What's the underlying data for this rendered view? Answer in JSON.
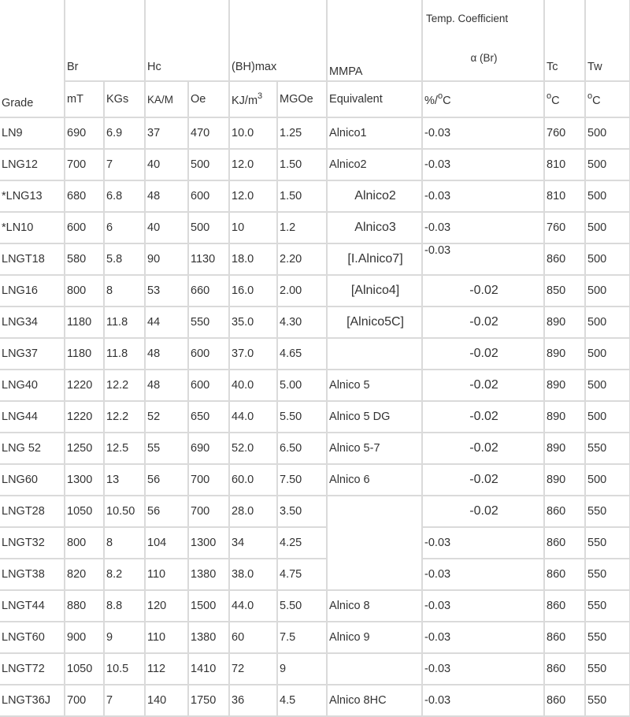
{
  "header": {
    "grade": "Grade",
    "br": "Br",
    "hc": "Hc",
    "bhmax": "(BH)max",
    "mmpa_line1": "MMPA",
    "mmpa_line2": "Equivalent",
    "temp_coef_title": "Temp. Coefficient",
    "temp_coef_symbol": "α (Br)",
    "tc": "Tc",
    "tw": "Tw",
    "unit_mt": "mT",
    "unit_kgs": "KGs",
    "unit_kam": "KA/M",
    "unit_oe": "Oe",
    "unit_kjm_base": "KJ/m",
    "unit_kjm_exp": "3",
    "unit_mgoe": "MGOe",
    "unit_pct_pre": "%/",
    "unit_deg": "o",
    "unit_c": "C"
  },
  "rows": [
    {
      "grade": "LN9",
      "mt": "690",
      "kgs": "6.9",
      "kam": "37",
      "oe": "470",
      "kjm": "10.0",
      "mgoe": "1.25",
      "mmpa": "Alnico1",
      "tcoef": "-0.03",
      "tc": "760",
      "tw": "500"
    },
    {
      "grade": "LNG12",
      "mt": "700",
      "kgs": "7",
      "kam": "40",
      "oe": "500",
      "kjm": "12.0",
      "mgoe": "1.50",
      "mmpa": "Alnico2",
      "tcoef": "-0.03",
      "tc": "810",
      "tw": "500"
    },
    {
      "grade": "*LNG13",
      "mt": "680",
      "kgs": "6.8",
      "kam": "48",
      "oe": "600",
      "kjm": "12.0",
      "mgoe": "1.50",
      "mmpa": "Alnico2",
      "tcoef": "-0.03",
      "tc": "810",
      "tw": "500"
    },
    {
      "grade": "*LN10",
      "mt": "600",
      "kgs": "6",
      "kam": "40",
      "oe": "500",
      "kjm": "10",
      "mgoe": "1.2",
      "mmpa": "Alnico3",
      "tcoef": "-0.03",
      "tc": "760",
      "tw": "500"
    },
    {
      "grade": "LNGT18",
      "mt": "580",
      "kgs": "5.8",
      "kam": "90",
      "oe": "1130",
      "kjm": "18.0",
      "mgoe": "2.20",
      "mmpa": "[I.Alnico7]",
      "tcoef": "-0.03",
      "tc": "860",
      "tw": "500"
    },
    {
      "grade": "LNG16",
      "mt": "800",
      "kgs": "8",
      "kam": "53",
      "oe": "660",
      "kjm": "16.0",
      "mgoe": "2.00",
      "mmpa": "[Alnico4]",
      "tcoef": "-0.02",
      "tc": "850",
      "tw": "500"
    },
    {
      "grade": "LNG34",
      "mt": "1180",
      "kgs": "11.8",
      "kam": "44",
      "oe": "550",
      "kjm": "35.0",
      "mgoe": "4.30",
      "mmpa": "[Alnico5C]",
      "tcoef": "-0.02",
      "tc": "890",
      "tw": "500"
    },
    {
      "grade": "LNG37",
      "mt": "1180",
      "kgs": "11.8",
      "kam": "48",
      "oe": "600",
      "kjm": "37.0",
      "mgoe": "4.65",
      "mmpa": "",
      "tcoef": "-0.02",
      "tc": "890",
      "tw": "500"
    },
    {
      "grade": "LNG40",
      "mt": "1220",
      "kgs": "12.2",
      "kam": "48",
      "oe": "600",
      "kjm": "40.0",
      "mgoe": "5.00",
      "mmpa": "Alnico 5",
      "tcoef": "-0.02",
      "tc": "890",
      "tw": "500"
    },
    {
      "grade": "LNG44",
      "mt": "1220",
      "kgs": "12.2",
      "kam": "52",
      "oe": "650",
      "kjm": "44.0",
      "mgoe": "5.50",
      "mmpa": "Alnico 5 DG",
      "tcoef": "-0.02",
      "tc": "890",
      "tw": "500"
    },
    {
      "grade": "LNG 52",
      "mt": "1250",
      "kgs": "12.5",
      "kam": "55",
      "oe": "690",
      "kjm": "52.0",
      "mgoe": "6.50",
      "mmpa": "Alnico 5-7",
      "tcoef": "-0.02",
      "tc": "890",
      "tw": "550"
    },
    {
      "grade": "LNG60",
      "mt": "1300",
      "kgs": "13",
      "kam": "56",
      "oe": "700",
      "kjm": "60.0",
      "mgoe": "7.50",
      "mmpa": "Alnico 6",
      "tcoef": "-0.02",
      "tc": "890",
      "tw": "500"
    },
    {
      "grade": "LNGT28",
      "mt": "1050",
      "kgs": "10.50",
      "kam": "56",
      "oe": "700",
      "kjm": "28.0",
      "mgoe": "3.50",
      "mmpa": "",
      "tcoef": "-0.02",
      "tc": "860",
      "tw": "550"
    },
    {
      "grade": "LNGT32",
      "mt": "800",
      "kgs": "8",
      "kam": "104",
      "oe": "1300",
      "kjm": "34",
      "mgoe": "4.25",
      "mmpa": "",
      "tcoef": "-0.03",
      "tc": "860",
      "tw": "550"
    },
    {
      "grade": "LNGT38",
      "mt": "820",
      "kgs": "8.2",
      "kam": "110",
      "oe": "1380",
      "kjm": "38.0",
      "mgoe": "4.75",
      "mmpa": "",
      "tcoef": "-0.03",
      "tc": "860",
      "tw": "550"
    },
    {
      "grade": "LNGT44",
      "mt": "880",
      "kgs": "8.8",
      "kam": "120",
      "oe": "1500",
      "kjm": "44.0",
      "mgoe": "5.50",
      "mmpa": "Alnico 8",
      "tcoef": "-0.03",
      "tc": "860",
      "tw": "550"
    },
    {
      "grade": "LNGT60",
      "mt": "900",
      "kgs": "9",
      "kam": "110",
      "oe": "1380",
      "kjm": "60",
      "mgoe": "7.5",
      "mmpa": "Alnico 9",
      "tcoef": "-0.03",
      "tc": "860",
      "tw": "550"
    },
    {
      "grade": "LNGT72",
      "mt": "1050",
      "kgs": "10.5",
      "kam": "112",
      "oe": "1410",
      "kjm": "72",
      "mgoe": "9",
      "mmpa": "",
      "tcoef": "-0.03",
      "tc": "860",
      "tw": "550"
    },
    {
      "grade": "LNGT36J",
      "mt": "700",
      "kgs": "7",
      "kam": "140",
      "oe": "1750",
      "kjm": "36",
      "mgoe": "4.5",
      "mmpa": "Alnico 8HC",
      "tcoef": "-0.03",
      "tc": "860",
      "tw": "550"
    }
  ]
}
